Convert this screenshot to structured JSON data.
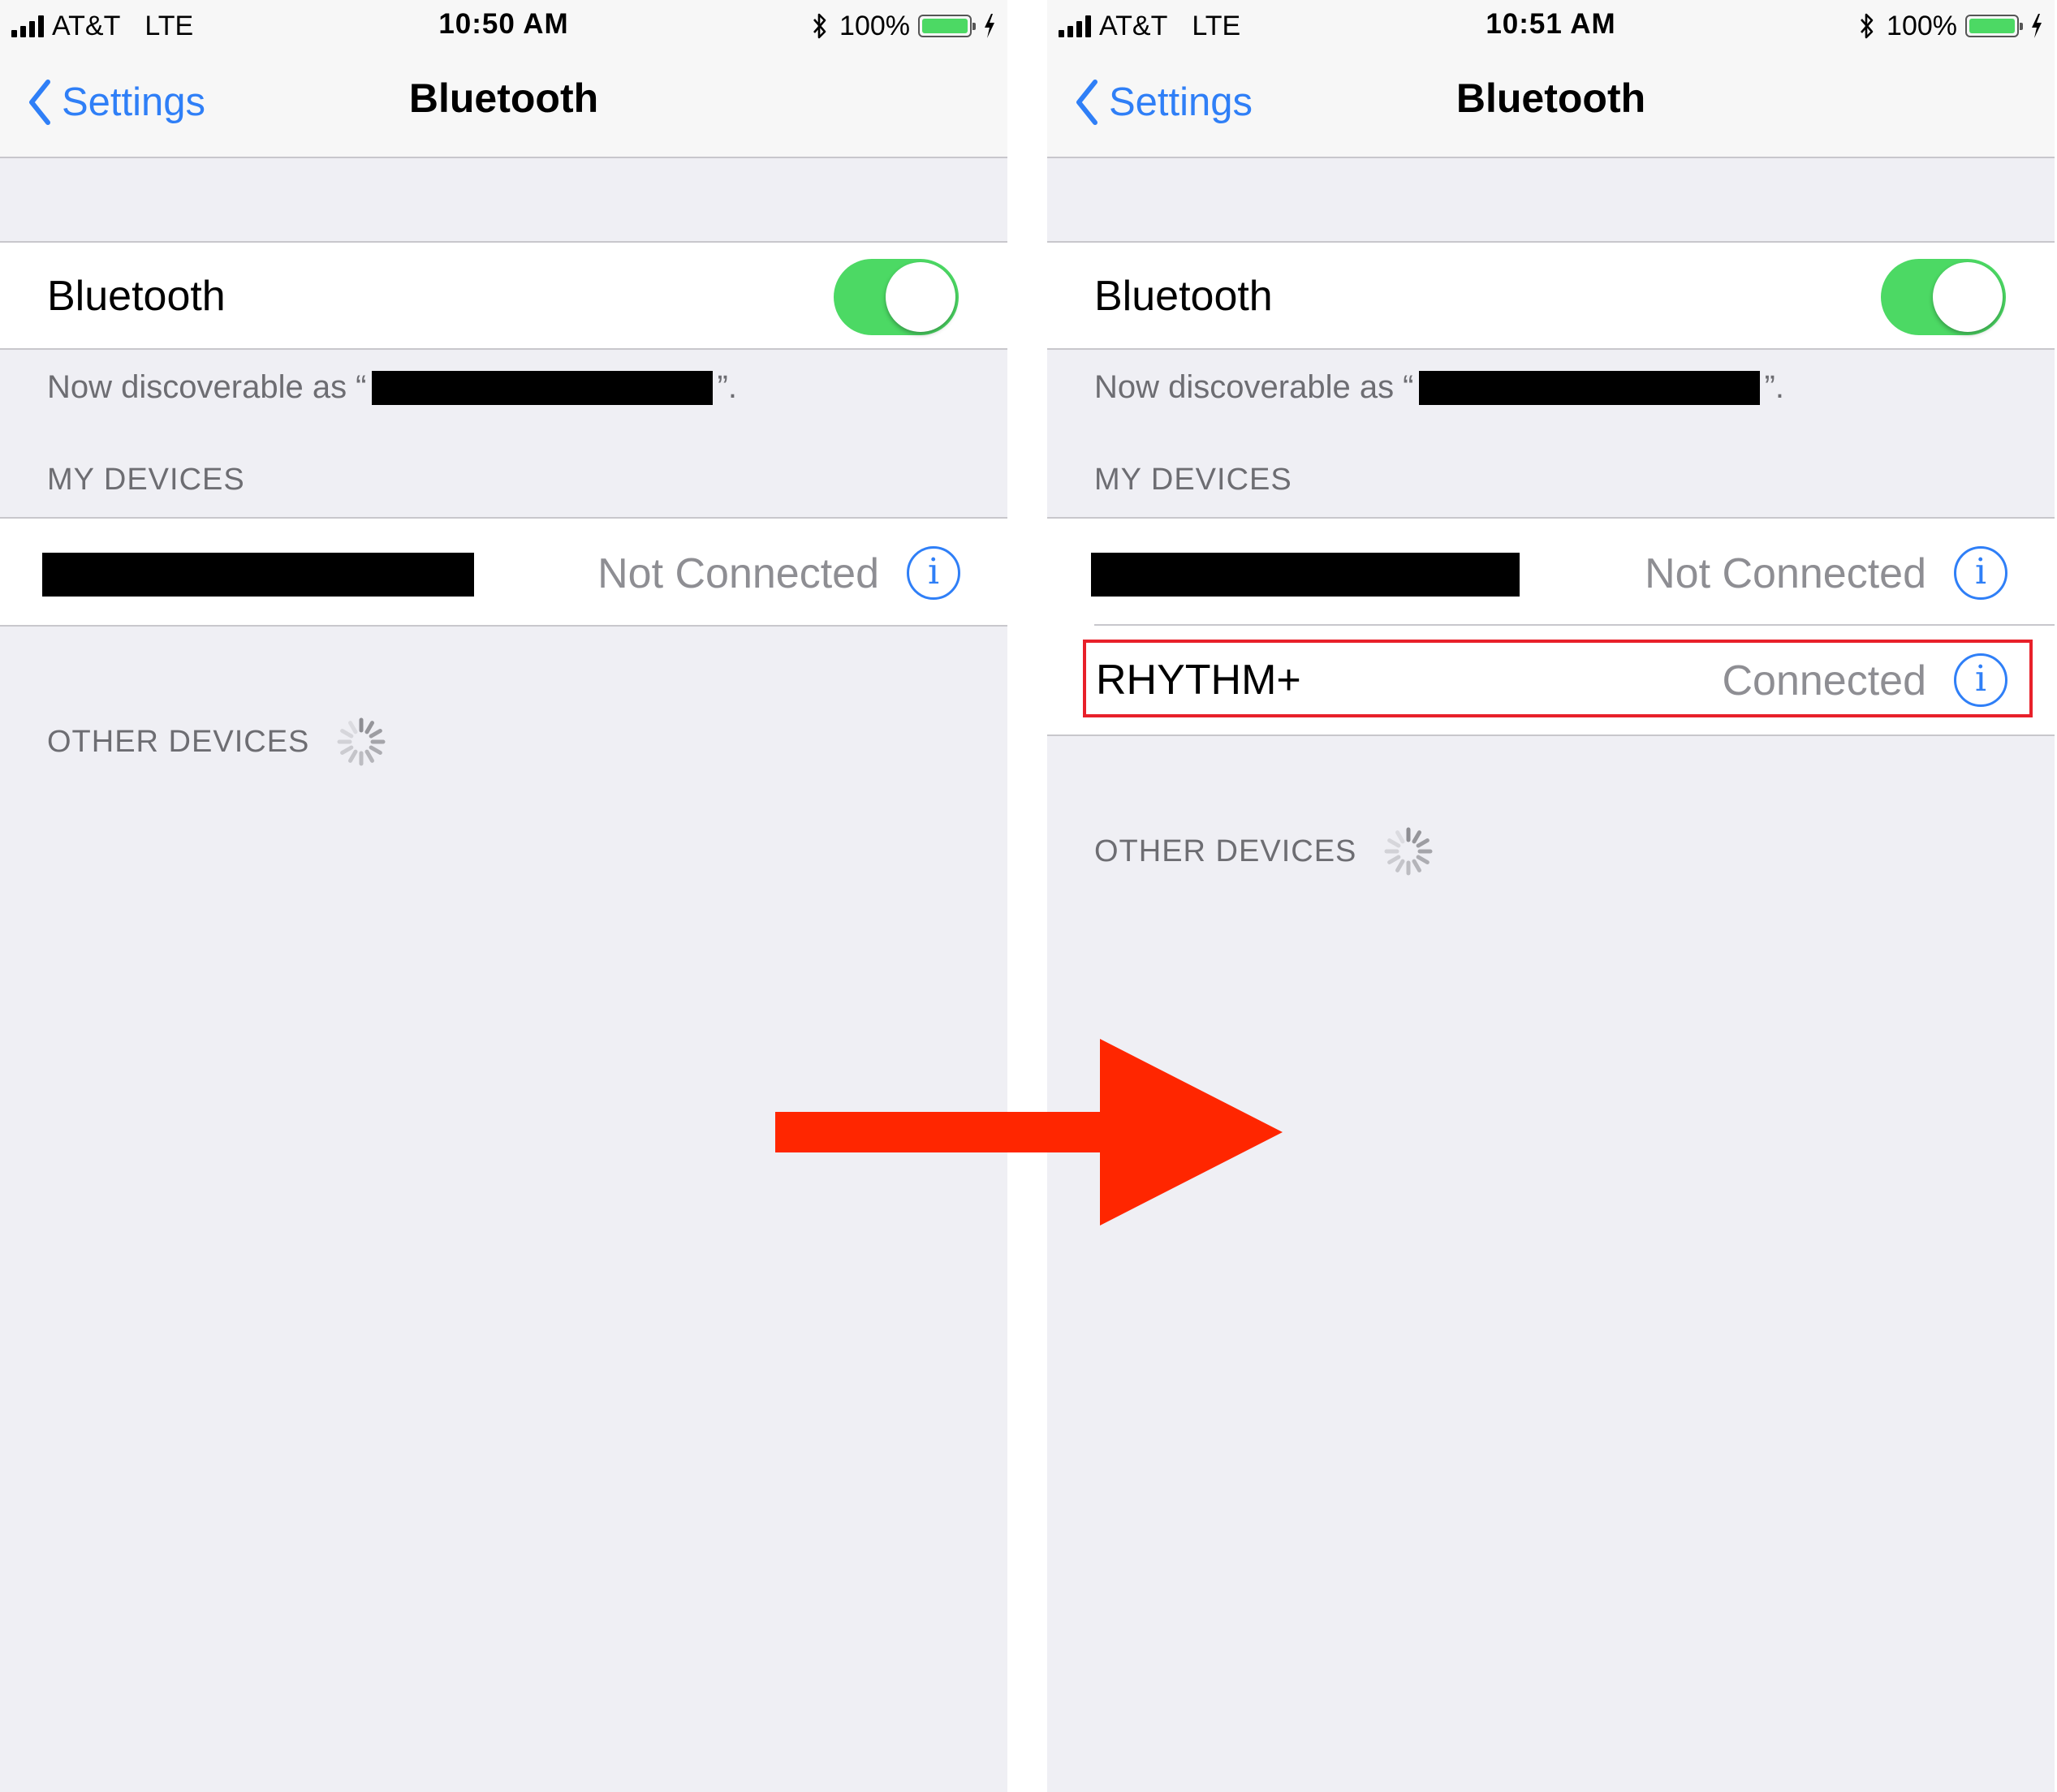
{
  "colors": {
    "accent": "#2f7ff7",
    "toggle_on": "#4cd964",
    "arrow": "#ff2600",
    "highlight": "#e8202a"
  },
  "screens": [
    {
      "status": {
        "carrier": "AT&T",
        "network": "LTE",
        "time": "10:50 AM",
        "battery": "100%"
      },
      "nav": {
        "back_label": "Settings",
        "title": "Bluetooth"
      },
      "bluetooth": {
        "label": "Bluetooth",
        "enabled": true
      },
      "discoverable": {
        "prefix": "Now discoverable as “",
        "suffix": "”."
      },
      "my_devices": {
        "header": "MY DEVICES",
        "items": [
          {
            "name": "",
            "redacted": true,
            "status": "Not Connected"
          }
        ]
      },
      "other_devices": {
        "header": "OTHER DEVICES",
        "loading": true
      }
    },
    {
      "status": {
        "carrier": "AT&T",
        "network": "LTE",
        "time": "10:51 AM",
        "battery": "100%"
      },
      "nav": {
        "back_label": "Settings",
        "title": "Bluetooth"
      },
      "bluetooth": {
        "label": "Bluetooth",
        "enabled": true
      },
      "discoverable": {
        "prefix": "Now discoverable as “",
        "suffix": "”."
      },
      "my_devices": {
        "header": "MY DEVICES",
        "items": [
          {
            "name": "",
            "redacted": true,
            "status": "Not Connected"
          },
          {
            "name": "RHYTHM+",
            "redacted": false,
            "status": "Connected",
            "highlighted": true
          }
        ]
      },
      "other_devices": {
        "header": "OTHER DEVICES",
        "loading": true
      }
    }
  ]
}
